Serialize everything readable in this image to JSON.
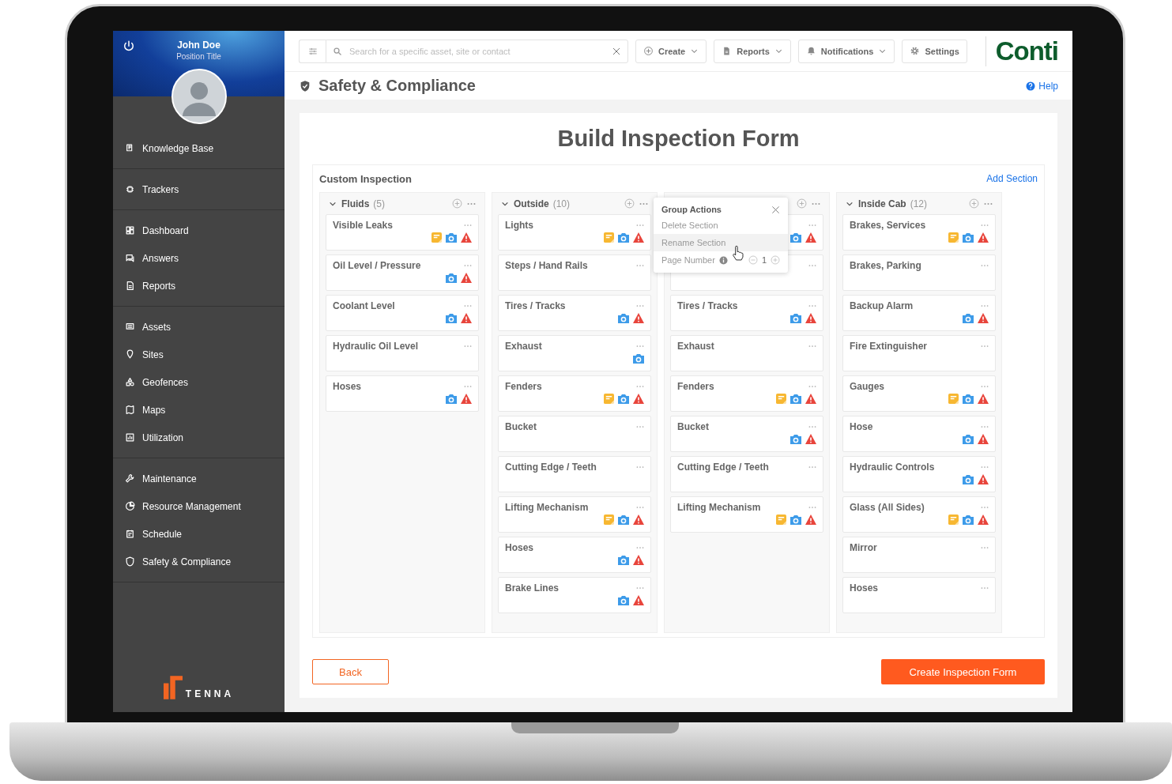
{
  "user": {
    "name": "John Doe",
    "position": "Position Title"
  },
  "sidebar": {
    "groups": [
      [
        {
          "label": "Knowledge Base"
        }
      ],
      [
        {
          "label": "Trackers"
        }
      ],
      [
        {
          "label": "Dashboard"
        },
        {
          "label": "Answers"
        },
        {
          "label": "Reports"
        }
      ],
      [
        {
          "label": "Assets"
        },
        {
          "label": "Sites"
        },
        {
          "label": "Geofences"
        },
        {
          "label": "Maps"
        },
        {
          "label": "Utilization"
        }
      ],
      [
        {
          "label": "Maintenance"
        },
        {
          "label": "Resource Management"
        },
        {
          "label": "Schedule"
        },
        {
          "label": "Safety & Compliance"
        }
      ]
    ],
    "footer_logo": "TENNA"
  },
  "toolbar": {
    "search": {
      "placeholder": "Search for a specific asset, site or contact"
    },
    "buttons": [
      {
        "label": "Create",
        "kind": "menu"
      },
      {
        "label": "Reports",
        "kind": "menu"
      },
      {
        "label": "Notifications",
        "kind": "menu"
      },
      {
        "label": "Settings",
        "kind": "plain"
      }
    ],
    "brand": "Conti"
  },
  "page": {
    "title": "Safety & Compliance",
    "help": "Help"
  },
  "form": {
    "title": "Build Inspection Form",
    "section": "Custom Inspection",
    "add_section": "Add Section",
    "columns": [
      {
        "title": "Fluids",
        "count": "(5)",
        "items": [
          {
            "title": "Visible Leaks",
            "note": true,
            "photo": true,
            "alert": true
          },
          {
            "title": "Oil Level / Pressure",
            "note": false,
            "photo": true,
            "alert": true
          },
          {
            "title": "Coolant Level",
            "note": false,
            "photo": true,
            "alert": true
          },
          {
            "title": "Hydraulic Oil Level",
            "note": false,
            "photo": false,
            "alert": false
          },
          {
            "title": "Hoses",
            "note": false,
            "photo": true,
            "alert": true
          }
        ]
      },
      {
        "title": "Outside",
        "count": "(10)",
        "items": [
          {
            "title": "Lights",
            "note": true,
            "photo": true,
            "alert": true
          },
          {
            "title": "Steps / Hand Rails",
            "note": false,
            "photo": false,
            "alert": false
          },
          {
            "title": "Tires / Tracks",
            "note": false,
            "photo": true,
            "alert": true
          },
          {
            "title": "Exhaust",
            "note": false,
            "photo": true,
            "alert": false
          },
          {
            "title": "Fenders",
            "note": true,
            "photo": true,
            "alert": true
          },
          {
            "title": "Bucket",
            "note": false,
            "photo": false,
            "alert": false
          },
          {
            "title": "Cutting Edge / Teeth",
            "note": false,
            "photo": false,
            "alert": false
          },
          {
            "title": "Lifting Mechanism",
            "note": true,
            "photo": true,
            "alert": true
          },
          {
            "title": "Hoses",
            "note": false,
            "photo": true,
            "alert": true
          },
          {
            "title": "Brake Lines",
            "note": false,
            "photo": true,
            "alert": true
          }
        ]
      },
      {
        "items": [
          {
            "note": false,
            "photo": true,
            "alert": true
          },
          {
            "note": false,
            "photo": false,
            "alert": false
          },
          {
            "title": "Tires / Tracks",
            "note": false,
            "photo": true,
            "alert": true
          },
          {
            "title": "Exhaust",
            "note": false,
            "photo": false,
            "alert": false
          },
          {
            "title": "Fenders",
            "note": true,
            "photo": true,
            "alert": true
          },
          {
            "title": "Bucket",
            "note": false,
            "photo": true,
            "alert": true
          },
          {
            "title": "Cutting Edge / Teeth",
            "note": false,
            "photo": false,
            "alert": false
          },
          {
            "title": "Lifting Mechanism",
            "note": true,
            "photo": true,
            "alert": true
          }
        ]
      },
      {
        "title": "Inside Cab",
        "count": "(12)",
        "items": [
          {
            "title": "Brakes, Services",
            "note": true,
            "photo": true,
            "alert": true
          },
          {
            "title": "Brakes, Parking",
            "note": false,
            "photo": false,
            "alert": false
          },
          {
            "title": "Backup Alarm",
            "note": false,
            "photo": true,
            "alert": true
          },
          {
            "title": "Fire Extinguisher",
            "note": false,
            "photo": false,
            "alert": false
          },
          {
            "title": "Gauges",
            "note": true,
            "photo": true,
            "alert": true
          },
          {
            "title": "Hose",
            "note": false,
            "photo": true,
            "alert": true
          },
          {
            "title": "Hydraulic Controls",
            "note": false,
            "photo": true,
            "alert": true
          },
          {
            "title": "Glass (All  Sides)",
            "note": true,
            "photo": true,
            "alert": true
          },
          {
            "title": "Mirror",
            "note": false,
            "photo": false,
            "alert": false
          },
          {
            "title": "Hoses",
            "note": false,
            "photo": false,
            "alert": false
          }
        ]
      }
    ],
    "popup": {
      "title": "Group Actions",
      "actions": [
        {
          "label": "Delete Section",
          "selected": false
        },
        {
          "label": "Rename Section",
          "selected": true
        }
      ],
      "page_label": "Page Number",
      "page_value": "1"
    },
    "buttons": {
      "back": "Back",
      "create": "Create Inspection Form"
    }
  }
}
